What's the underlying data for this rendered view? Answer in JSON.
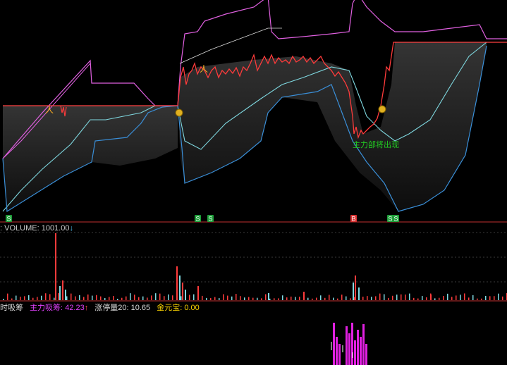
{
  "panels": {
    "volume_header": {
      "label": "VOLUME:",
      "value": "1001.00",
      "arrow": "↓"
    },
    "indicator_header": {
      "name_fragment": "时吸筹",
      "items": [
        {
          "label": "主力吸筹:",
          "value": "42.23",
          "arrow": "↑",
          "color": "#e040fb"
        },
        {
          "label": "涨停量20:",
          "value": "10.65",
          "color": "#dddddd"
        },
        {
          "label": "金元宝:",
          "value": "0.00",
          "color": "#ffd700"
        }
      ]
    }
  },
  "signals": {
    "s_marker_text": "S",
    "b_marker_text": "B",
    "s_markers_count": 5,
    "b_markers_count": 1,
    "price_annotation": "主力部将出现"
  },
  "colors": {
    "price": "#ff3b3b",
    "upper_band": "#e060e0",
    "mid_band": "#7fd8e0",
    "lower_band": "#3a8fd8",
    "baseline": "#ff4040",
    "marker_s": "#1e9e3a",
    "marker_b": "#d83030",
    "annotation": "#22cc22"
  },
  "chart_data": [
    {
      "type": "line",
      "name": "price-panel",
      "x": [
        0,
        10,
        20,
        30,
        40,
        50,
        60,
        70,
        80,
        90,
        100,
        110,
        120
      ],
      "series": [
        {
          "values": [
            50,
            50,
            50,
            50,
            50,
            50,
            50,
            50,
            50,
            50,
            50,
            50,
            50
          ]
        }
      ]
    },
    {
      "type": "bar",
      "name": "volume-panel",
      "values_note_max": 1001.0
    },
    {
      "type": "bar",
      "name": "indicator-panel",
      "values_visible": [
        42.23,
        10.65,
        0.0
      ]
    }
  ]
}
